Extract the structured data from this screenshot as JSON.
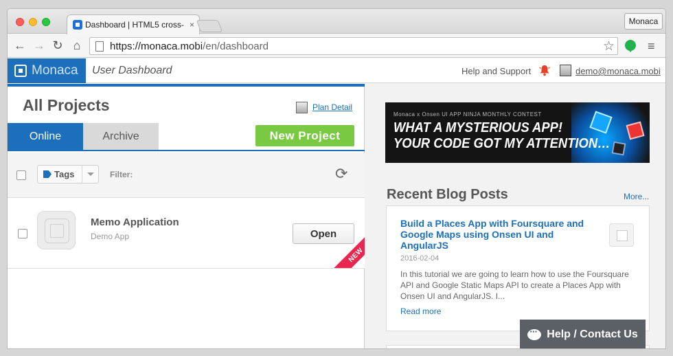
{
  "browser": {
    "tab_title": "Dashboard | HTML5 cross-",
    "tab_close": "×",
    "profile_label": "Monaca",
    "url_host": "https://monaca.mobi",
    "url_path": "/en/dashboard",
    "icons": {
      "back": "←",
      "forward": "→",
      "reload": "↻",
      "home": "⌂",
      "star": "☆",
      "menu": "≡"
    }
  },
  "header": {
    "logo_text": "Monaca",
    "title": "User Dashboard",
    "help_label": "Help and Support",
    "user_email": "demo@monaca.mobi",
    "colors": {
      "brand": "#1c6fba",
      "bell": "#e0452a"
    }
  },
  "projects": {
    "heading": "All Projects",
    "plan_link": "Plan Detail",
    "tabs": {
      "online": "Online",
      "archive": "Archive"
    },
    "new_project_label": "New Project",
    "tags_label": "Tags",
    "filter_label": "Filter:",
    "refresh_icon": "⟳",
    "items": [
      {
        "name": "Memo Application",
        "subtitle": "Demo App",
        "open_label": "Open",
        "badge": "NEW"
      }
    ]
  },
  "banner": {
    "small_text": "Monaca x Onsen UI  APP NINJA MONTHLY CONTEST",
    "line1": "WHAT A MYSTERIOUS APP!",
    "line2": "YOUR CODE GOT MY ATTENTION…"
  },
  "blog": {
    "heading": "Recent Blog Posts",
    "more_label": "More...",
    "posts": [
      {
        "title": "Build a Places App with Foursquare and Google Maps using Onsen UI and AngularJS",
        "date": "2016-02-04",
        "excerpt": "In this tutorial we are going to learn how to use the Foursquare API and Google Static Maps API to create a Places App with Onsen UI and AngularJS. I...",
        "read_more": "Read more"
      }
    ]
  },
  "help_widget": {
    "label": "Help / Contact Us"
  }
}
